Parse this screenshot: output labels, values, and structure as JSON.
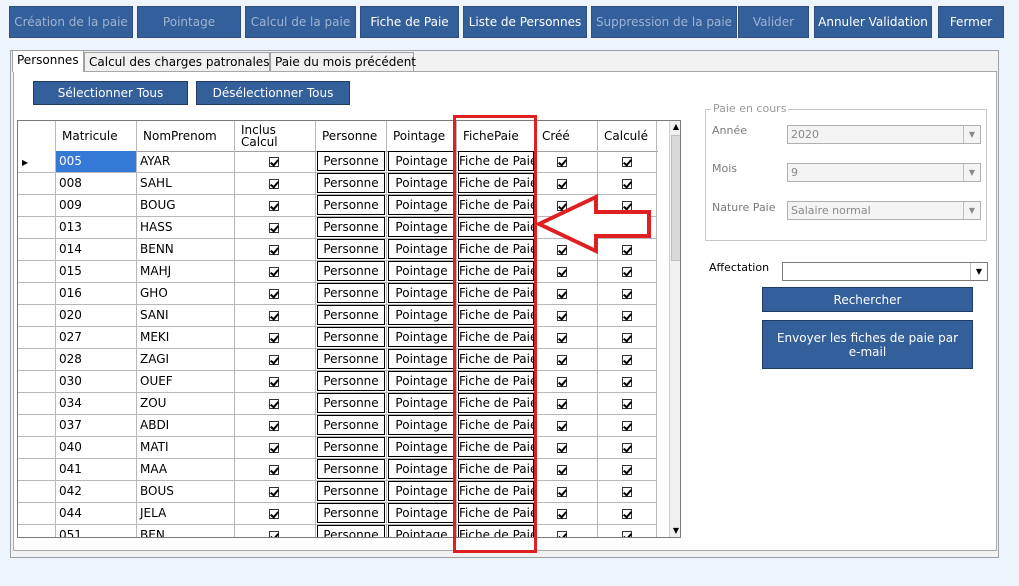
{
  "toolbar": [
    {
      "label": "Création de la paie",
      "enabled": false
    },
    {
      "label": "Pointage",
      "enabled": false
    },
    {
      "label": "Calcul de la paie",
      "enabled": false
    },
    {
      "label": "Fiche de Paie",
      "enabled": true
    },
    {
      "label": "Liste de Personnes",
      "enabled": true
    },
    {
      "label": "Suppression de la paie",
      "enabled": false
    },
    {
      "label": "Valider",
      "enabled": false
    },
    {
      "label": "Annuler Validation",
      "enabled": true
    },
    {
      "label": "Fermer",
      "enabled": true
    }
  ],
  "tabs": [
    {
      "label": "Personnes",
      "active": true
    },
    {
      "label": "Calcul des charges patronales",
      "active": false
    },
    {
      "label": "Paie du mois précédent",
      "active": false
    }
  ],
  "select_all_label": "Sélectionner Tous",
  "deselect_all_label": "Désélectionner Tous",
  "grid": {
    "columns": [
      "Matricule",
      "NomPrenom",
      "Inclus Calcul",
      "Personne",
      "Pointage",
      "FichePaie",
      "Créé",
      "Calculé"
    ],
    "person_button": "Personne",
    "pointage_button": "Pointage",
    "fiche_button": "Fiche de Paie",
    "rows": [
      {
        "matricule": "005",
        "nom": "AYAR"
      },
      {
        "matricule": "008",
        "nom": "SAHL"
      },
      {
        "matricule": "009",
        "nom": "BOUG"
      },
      {
        "matricule": "013",
        "nom": "HASS"
      },
      {
        "matricule": "014",
        "nom": "BENN"
      },
      {
        "matricule": "015",
        "nom": "MAHJ"
      },
      {
        "matricule": "016",
        "nom": "GHO"
      },
      {
        "matricule": "020",
        "nom": "SANI"
      },
      {
        "matricule": "027",
        "nom": "MEKI"
      },
      {
        "matricule": "028",
        "nom": "ZAGI"
      },
      {
        "matricule": "030",
        "nom": "OUEF"
      },
      {
        "matricule": "034",
        "nom": "ZOU"
      },
      {
        "matricule": "037",
        "nom": "ABDI"
      },
      {
        "matricule": "040",
        "nom": "MATI"
      },
      {
        "matricule": "041",
        "nom": "MAA"
      },
      {
        "matricule": "042",
        "nom": "BOUS"
      },
      {
        "matricule": "044",
        "nom": "JELA"
      },
      {
        "matricule": "051",
        "nom": "BEN"
      }
    ]
  },
  "paie_en_cours": {
    "legend": "Paie en cours",
    "annee_label": "Année",
    "annee_value": "2020",
    "mois_label": "Mois",
    "mois_value": "9",
    "nature_label": "Nature Paie",
    "nature_value": "Salaire normal"
  },
  "affectation_label": "Affectation",
  "affectation_value": "",
  "rechercher_label": "Rechercher",
  "envoyer_label": "Envoyer les fiches de paie par e-mail",
  "colors": {
    "button": "#33609b",
    "highlight": "#e02020",
    "selected": "#3479d6"
  }
}
